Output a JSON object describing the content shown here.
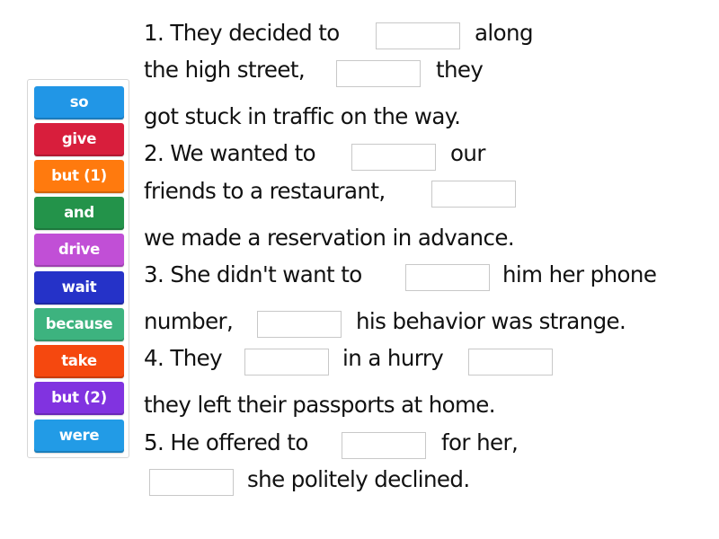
{
  "tiles": [
    {
      "label": "so",
      "color": "#2196e6"
    },
    {
      "label": "give",
      "color": "#d81e3c"
    },
    {
      "label": "but (1)",
      "color": "#ff7a0e"
    },
    {
      "label": "and",
      "color": "#23934a"
    },
    {
      "label": "drive",
      "color": "#c14fd6"
    },
    {
      "label": "wait",
      "color": "#2532c8"
    },
    {
      "label": "because",
      "color": "#3db37f"
    },
    {
      "label": "take",
      "color": "#f5480f"
    },
    {
      "label": "but (2)",
      "color": "#8133e0"
    },
    {
      "label": "were",
      "color": "#229be6"
    }
  ],
  "sentences": {
    "l1a": "1. They decided to",
    "l1b": "along",
    "l2a": "the high street,",
    "l2b": "they",
    "l3": "got stuck in traffic on the way.",
    "l4a": "2. We wanted to",
    "l4b": "our",
    "l5a": "friends to a restaurant,",
    "l6": "we made a reservation in advance.",
    "l7a": "3. She didn't want to",
    "l7b": "him her phone",
    "l8a": "number,",
    "l8b": "his behavior was strange.",
    "l9a": "4. They",
    "l9b": "in a hurry",
    "l10": "they left their passports at home.",
    "l11a": "5. He offered to",
    "l11b": "for her,",
    "l12b": "she politely declined."
  },
  "blanks": [
    "",
    "",
    "",
    "",
    "",
    "",
    "",
    "",
    "",
    ""
  ]
}
